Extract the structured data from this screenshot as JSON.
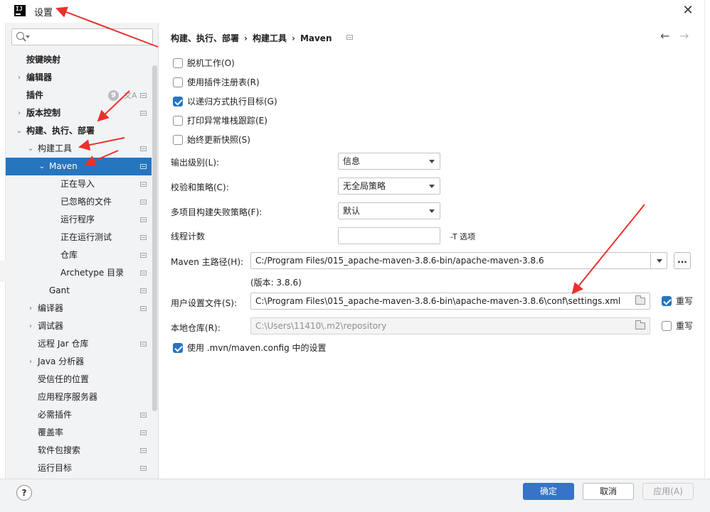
{
  "window": {
    "title": "设置",
    "app_icon_text": "IJ"
  },
  "search": {
    "placeholder": "",
    "value": ""
  },
  "sidebar": {
    "items": [
      {
        "label": "按键映射",
        "level": 0,
        "arrow": "",
        "bold": true,
        "page_icon": false
      },
      {
        "label": "编辑器",
        "level": 0,
        "arrow": "›",
        "bold": true,
        "page_icon": false
      },
      {
        "label": "插件",
        "level": 0,
        "arrow": "",
        "bold": true,
        "page_icon": true,
        "badge": "9"
      },
      {
        "label": "版本控制",
        "level": 0,
        "arrow": "›",
        "bold": true,
        "page_icon": true
      },
      {
        "label": "构建、执行、部署",
        "level": 0,
        "arrow": "⌄",
        "bold": true,
        "page_icon": false
      },
      {
        "label": "构建工具",
        "level": 1,
        "arrow": "⌄",
        "bold": false,
        "page_icon": true
      },
      {
        "label": "Maven",
        "level": 2,
        "arrow": "⌄",
        "bold": false,
        "page_icon": true,
        "selected": true
      },
      {
        "label": "正在导入",
        "level": 3,
        "arrow": "",
        "bold": false,
        "page_icon": true
      },
      {
        "label": "已忽略的文件",
        "level": 3,
        "arrow": "",
        "bold": false,
        "page_icon": true
      },
      {
        "label": "运行程序",
        "level": 3,
        "arrow": "",
        "bold": false,
        "page_icon": true
      },
      {
        "label": "正在运行测试",
        "level": 3,
        "arrow": "",
        "bold": false,
        "page_icon": true
      },
      {
        "label": "仓库",
        "level": 3,
        "arrow": "",
        "bold": false,
        "page_icon": true
      },
      {
        "label": "Archetype 目录",
        "level": 3,
        "arrow": "",
        "bold": false,
        "page_icon": true
      },
      {
        "label": "Gant",
        "level": 2,
        "arrow": "",
        "bold": false,
        "page_icon": true
      },
      {
        "label": "编译器",
        "level": 1,
        "arrow": "›",
        "bold": false,
        "page_icon": true
      },
      {
        "label": "调试器",
        "level": 1,
        "arrow": "›",
        "bold": false,
        "page_icon": false
      },
      {
        "label": "远程 Jar 仓库",
        "level": 1,
        "arrow": "",
        "bold": false,
        "page_icon": true
      },
      {
        "label": "Java 分析器",
        "level": 1,
        "arrow": "›",
        "bold": false,
        "page_icon": false
      },
      {
        "label": "受信任的位置",
        "level": 1,
        "arrow": "",
        "bold": false,
        "page_icon": false
      },
      {
        "label": "应用程序服务器",
        "level": 1,
        "arrow": "",
        "bold": false,
        "page_icon": false
      },
      {
        "label": "必需插件",
        "level": 1,
        "arrow": "",
        "bold": false,
        "page_icon": true
      },
      {
        "label": "覆盖率",
        "level": 1,
        "arrow": "",
        "bold": false,
        "page_icon": true
      },
      {
        "label": "软件包搜索",
        "level": 1,
        "arrow": "",
        "bold": false,
        "page_icon": true
      },
      {
        "label": "运行目标",
        "level": 1,
        "arrow": "",
        "bold": false,
        "page_icon": true
      }
    ]
  },
  "breadcrumb": [
    "构建、执行、部署",
    "构建工具",
    "Maven"
  ],
  "nav": {
    "back": "←",
    "forward": "→"
  },
  "options": [
    {
      "label": "脱机工作(O)",
      "checked": false
    },
    {
      "label": "使用插件注册表(R)",
      "checked": false
    },
    {
      "label": "以递归方式执行目标(G)",
      "checked": true
    },
    {
      "label": "打印异常堆栈跟踪(E)",
      "checked": false
    },
    {
      "label": "始终更新快照(S)",
      "checked": false
    }
  ],
  "fields": {
    "output_level": {
      "label": "输出级别(L):",
      "value": "信息"
    },
    "checksum_policy": {
      "label": "校验和策略(C):",
      "value": "无全局策略"
    },
    "fail_policy": {
      "label": "多项目构建失败策略(F):",
      "value": "默认"
    },
    "thread_count": {
      "label": "线程计数",
      "value": "",
      "hint": "-T 选项"
    },
    "maven_home": {
      "label": "Maven 主路径(H):",
      "value": "C:/Program Files/015_apache-maven-3.8.6-bin/apache-maven-3.8.6",
      "version": "(版本: 3.8.6)"
    },
    "user_settings": {
      "label": "用户设置文件(S):",
      "value": "C:\\Program Files\\015_apache-maven-3.8.6-bin\\apache-maven-3.8.6\\conf\\settings.xml",
      "override_label": "重写",
      "override_checked": true
    },
    "local_repo": {
      "label": "本地仓库(R):",
      "value": "C:\\Users\\11410\\.m2\\repository",
      "override_label": "重写",
      "override_checked": false
    },
    "mvn_config": {
      "label": "使用 .mvn/maven.config 中的设置",
      "checked": true
    }
  },
  "footer": {
    "help": "?",
    "ok": "确定",
    "cancel": "取消",
    "apply": "应用(A)"
  },
  "colors": {
    "selection": "#2675bf",
    "primary_button": "#3574c8",
    "annotation_arrow": "#e8322d"
  }
}
